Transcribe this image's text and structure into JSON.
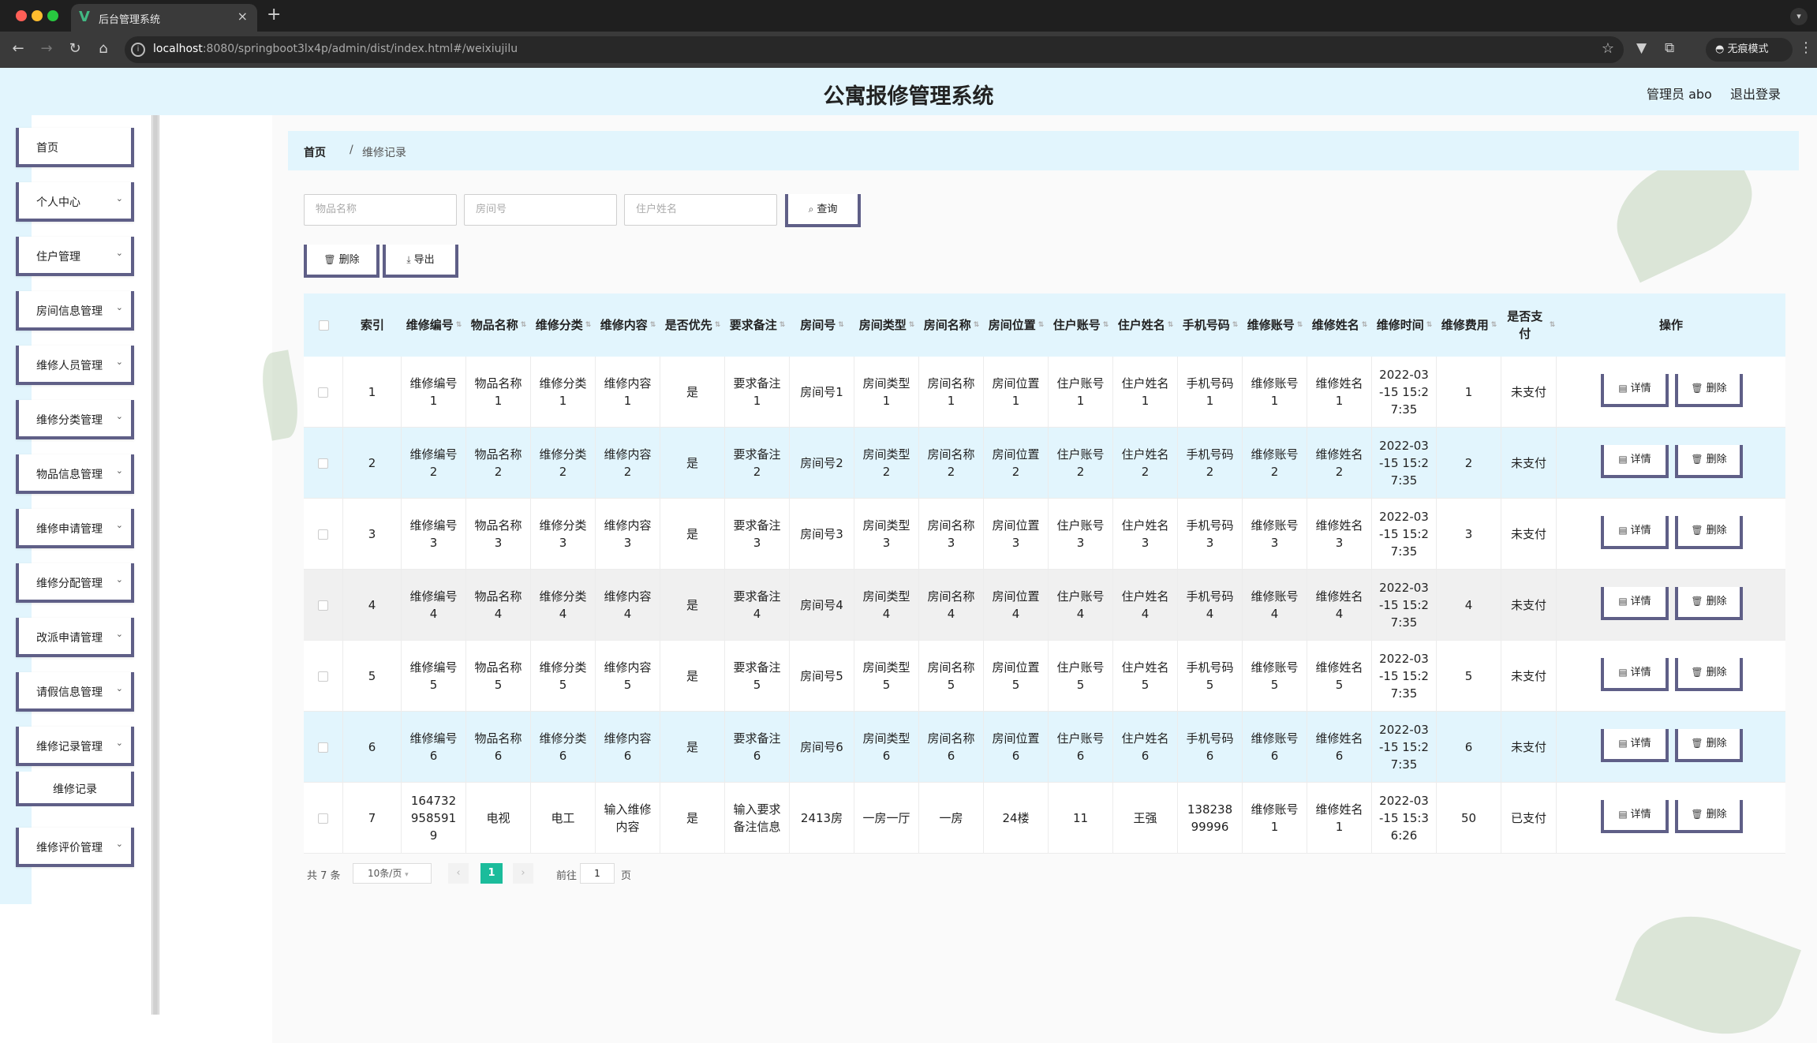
{
  "browser": {
    "tab_title": "后台管理系统",
    "url_host": "localhost",
    "url_rest": ":8080/springboot3lx4p/admin/dist/index.html#/weixiujilu",
    "incognito_label": "无痕模式"
  },
  "header": {
    "title": "公寓报修管理系统",
    "admin": "管理员 abo",
    "logout": "退出登录"
  },
  "sidebar": {
    "items": [
      {
        "label": "首页",
        "has_arrow": false
      },
      {
        "label": "个人中心",
        "has_arrow": true
      },
      {
        "label": "住户管理",
        "has_arrow": true
      },
      {
        "label": "房间信息管理",
        "has_arrow": true
      },
      {
        "label": "维修人员管理",
        "has_arrow": true
      },
      {
        "label": "维修分类管理",
        "has_arrow": true
      },
      {
        "label": "物品信息管理",
        "has_arrow": true
      },
      {
        "label": "维修申请管理",
        "has_arrow": true
      },
      {
        "label": "维修分配管理",
        "has_arrow": true
      },
      {
        "label": "改派申请管理",
        "has_arrow": true
      },
      {
        "label": "请假信息管理",
        "has_arrow": true
      },
      {
        "label": "维修记录管理",
        "has_arrow": true
      }
    ],
    "subitem": "维修记录",
    "last_item": "维修评价管理"
  },
  "breadcrumb": {
    "home": "首页",
    "sep": "/",
    "current": "维修记录"
  },
  "search": {
    "item_name_placeholder": "物品名称",
    "room_placeholder": "房间号",
    "resident_placeholder": "住户姓名",
    "query_label": "查询"
  },
  "toolbar": {
    "delete_label": "删除",
    "export_label": "导出"
  },
  "table": {
    "columns": [
      "索引",
      "维修编号",
      "物品名称",
      "维修分类",
      "维修内容",
      "是否优先",
      "要求备注",
      "房间号",
      "房间类型",
      "房间名称",
      "房间位置",
      "住户账号",
      "住户姓名",
      "手机号码",
      "维修账号",
      "维修姓名",
      "维修时间",
      "维修费用",
      "是否支付",
      "操作"
    ],
    "rows": [
      [
        "1",
        "维修编号1",
        "物品名称1",
        "维修分类1",
        "维修内容1",
        "是",
        "要求备注1",
        "房间号1",
        "房间类型1",
        "房间名称1",
        "房间位置1",
        "住户账号1",
        "住户姓名1",
        "手机号码1",
        "维修账号1",
        "维修姓名1",
        "2022-03-15 15:27:35",
        "1",
        "未支付"
      ],
      [
        "2",
        "维修编号2",
        "物品名称2",
        "维修分类2",
        "维修内容2",
        "是",
        "要求备注2",
        "房间号2",
        "房间类型2",
        "房间名称2",
        "房间位置2",
        "住户账号2",
        "住户姓名2",
        "手机号码2",
        "维修账号2",
        "维修姓名2",
        "2022-03-15 15:27:35",
        "2",
        "未支付"
      ],
      [
        "3",
        "维修编号3",
        "物品名称3",
        "维修分类3",
        "维修内容3",
        "是",
        "要求备注3",
        "房间号3",
        "房间类型3",
        "房间名称3",
        "房间位置3",
        "住户账号3",
        "住户姓名3",
        "手机号码3",
        "维修账号3",
        "维修姓名3",
        "2022-03-15 15:27:35",
        "3",
        "未支付"
      ],
      [
        "4",
        "维修编号4",
        "物品名称4",
        "维修分类4",
        "维修内容4",
        "是",
        "要求备注4",
        "房间号4",
        "房间类型4",
        "房间名称4",
        "房间位置4",
        "住户账号4",
        "住户姓名4",
        "手机号码4",
        "维修账号4",
        "维修姓名4",
        "2022-03-15 15:27:35",
        "4",
        "未支付"
      ],
      [
        "5",
        "维修编号5",
        "物品名称5",
        "维修分类5",
        "维修内容5",
        "是",
        "要求备注5",
        "房间号5",
        "房间类型5",
        "房间名称5",
        "房间位置5",
        "住户账号5",
        "住户姓名5",
        "手机号码5",
        "维修账号5",
        "维修姓名5",
        "2022-03-15 15:27:35",
        "5",
        "未支付"
      ],
      [
        "6",
        "维修编号6",
        "物品名称6",
        "维修分类6",
        "维修内容6",
        "是",
        "要求备注6",
        "房间号6",
        "房间类型6",
        "房间名称6",
        "房间位置6",
        "住户账号6",
        "住户姓名6",
        "手机号码6",
        "维修账号6",
        "维修姓名6",
        "2022-03-15 15:27:35",
        "6",
        "未支付"
      ],
      [
        "7",
        "1647329585919",
        "电视",
        "电工",
        "输入维修内容",
        "是",
        "输入要求备注信息",
        "2413房",
        "一房一厅",
        "一房",
        "24楼",
        "11",
        "王强",
        "13823899996",
        "维修账号1",
        "维修姓名1",
        "2022-03-15 15:36:26",
        "50",
        "已支付"
      ]
    ],
    "detail_label": "详情",
    "delete_label": "删除"
  },
  "pagination": {
    "total": "共 7 条",
    "page_size": "10条/页",
    "current": "1",
    "goto_label": "前往",
    "goto_value": "1",
    "page_suffix": "页"
  },
  "colors": {
    "accent_bg": "#e2f5fd",
    "button_border": "#5f5f87",
    "page_active": "#1bbc9b"
  }
}
